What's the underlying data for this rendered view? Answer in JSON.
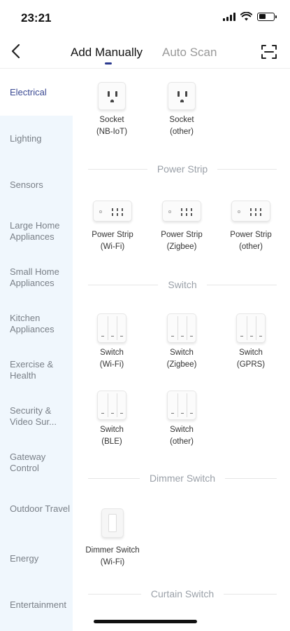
{
  "status_bar": {
    "time": "23:21"
  },
  "nav": {
    "tab_manual": "Add Manually",
    "tab_scan": "Auto Scan"
  },
  "sidebar": {
    "categories": [
      {
        "label": "Electrical",
        "active": true
      },
      {
        "label": "Lighting"
      },
      {
        "label": "Sensors"
      },
      {
        "label": "Large Home Appliances"
      },
      {
        "label": "Small Home Appliances"
      },
      {
        "label": "Kitchen Appliances"
      },
      {
        "label": "Exercise & Health"
      },
      {
        "label": "Security & Video Sur..."
      },
      {
        "label": "Gateway Control"
      },
      {
        "label": "Outdoor Travel"
      },
      {
        "label": "Energy"
      },
      {
        "label": "Entertainment"
      }
    ]
  },
  "content": {
    "sockets": [
      {
        "name": "Socket",
        "variant": "(NB-IoT)"
      },
      {
        "name": "Socket",
        "variant": "(other)"
      }
    ],
    "section_power_strip": "Power Strip",
    "power_strips": [
      {
        "name": "Power Strip",
        "variant": "(Wi-Fi)"
      },
      {
        "name": "Power Strip",
        "variant": "(Zigbee)"
      },
      {
        "name": "Power Strip",
        "variant": "(other)"
      }
    ],
    "section_switch": "Switch",
    "switches": [
      {
        "name": "Switch",
        "variant": "(Wi-Fi)"
      },
      {
        "name": "Switch",
        "variant": "(Zigbee)"
      },
      {
        "name": "Switch",
        "variant": "(GPRS)"
      },
      {
        "name": "Switch",
        "variant": "(BLE)"
      },
      {
        "name": "Switch",
        "variant": "(other)"
      }
    ],
    "section_dimmer": "Dimmer Switch",
    "dimmers": [
      {
        "name": "Dimmer Switch",
        "variant": "(Wi-Fi)"
      }
    ],
    "section_curtain": "Curtain Switch"
  },
  "icons": {
    "back": "chevron-left-icon",
    "scan": "scan-frame-icon",
    "signal": "cellular-signal-icon",
    "wifi": "wifi-icon",
    "battery": "battery-icon"
  },
  "colors": {
    "accent": "#2b3a8f",
    "sidebar_bg": "#f0f7fd",
    "active_text": "#3b4a93"
  }
}
